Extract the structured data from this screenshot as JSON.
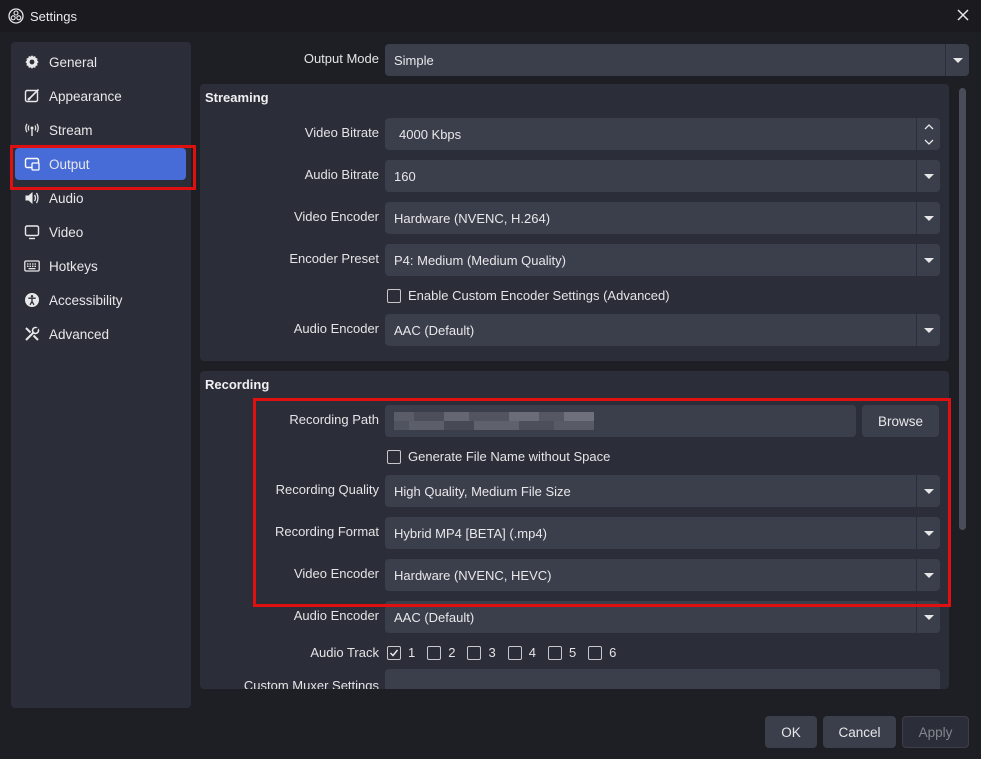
{
  "window": {
    "title": "Settings"
  },
  "sidebar": {
    "items": [
      {
        "label": "General",
        "icon": "gear-icon"
      },
      {
        "label": "Appearance",
        "icon": "appearance-icon"
      },
      {
        "label": "Stream",
        "icon": "antenna-icon"
      },
      {
        "label": "Output",
        "icon": "output-icon",
        "active": true
      },
      {
        "label": "Audio",
        "icon": "speaker-icon"
      },
      {
        "label": "Video",
        "icon": "monitor-icon"
      },
      {
        "label": "Hotkeys",
        "icon": "keyboard-icon"
      },
      {
        "label": "Accessibility",
        "icon": "accessibility-icon"
      },
      {
        "label": "Advanced",
        "icon": "tools-icon"
      }
    ]
  },
  "output_mode": {
    "label": "Output Mode",
    "value": "Simple"
  },
  "streaming": {
    "title": "Streaming",
    "video_bitrate": {
      "label": "Video Bitrate",
      "value": "4000 Kbps"
    },
    "audio_bitrate": {
      "label": "Audio Bitrate",
      "value": "160"
    },
    "video_encoder": {
      "label": "Video Encoder",
      "value": "Hardware (NVENC, H.264)"
    },
    "encoder_preset": {
      "label": "Encoder Preset",
      "value": "P4: Medium (Medium Quality)"
    },
    "custom_encoder": {
      "label": "Enable Custom Encoder Settings (Advanced)",
      "checked": false
    },
    "audio_encoder": {
      "label": "Audio Encoder",
      "value": "AAC (Default)"
    }
  },
  "recording": {
    "title": "Recording",
    "path": {
      "label": "Recording Path",
      "browse_label": "Browse"
    },
    "filename_nospace": {
      "label": "Generate File Name without Space",
      "checked": false
    },
    "quality": {
      "label": "Recording Quality",
      "value": "High Quality, Medium File Size"
    },
    "format": {
      "label": "Recording Format",
      "value": "Hybrid MP4 [BETA] (.mp4)"
    },
    "video_encoder": {
      "label": "Video Encoder",
      "value": "Hardware (NVENC, HEVC)"
    },
    "audio_encoder": {
      "label": "Audio Encoder",
      "value": "AAC (Default)"
    },
    "audio_track": {
      "label": "Audio Track",
      "tracks": [
        {
          "label": "1",
          "checked": true
        },
        {
          "label": "2",
          "checked": false
        },
        {
          "label": "3",
          "checked": false
        },
        {
          "label": "4",
          "checked": false
        },
        {
          "label": "5",
          "checked": false
        },
        {
          "label": "6",
          "checked": false
        }
      ]
    },
    "custom_muxer": {
      "label": "Custom Muxer Settings",
      "value": ""
    }
  },
  "footer": {
    "ok_label": "OK",
    "cancel_label": "Cancel",
    "apply_label": "Apply"
  },
  "colors": {
    "accent": "#476bd7",
    "highlight": "#e01010",
    "panel": "#2b2e38",
    "field": "#3b3e4b"
  }
}
